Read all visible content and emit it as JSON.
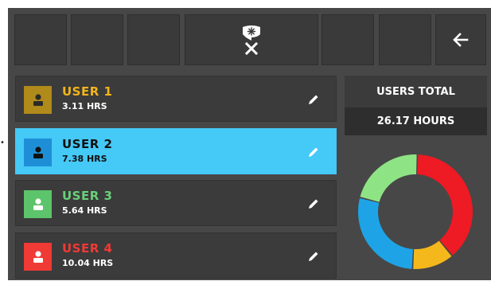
{
  "toolbar": {
    "left_buttons": [
      "",
      "",
      ""
    ],
    "right_buttons": [
      "",
      ""
    ],
    "center_icon": "fan-heater-off-icon",
    "back_icon": "arrow-left-icon"
  },
  "users": [
    {
      "name": "USER 1",
      "hours": "3.11 HRS",
      "color": "#b08a1a",
      "name_color": "#f2b41c",
      "selected": false
    },
    {
      "name": "USER 2",
      "hours": "7.38 HRS",
      "color": "#1e8fd6",
      "name_color": "#111111",
      "selected": true
    },
    {
      "name": "USER 3",
      "hours": "5.64 HRS",
      "color": "#5cc46a",
      "name_color": "#6ad07a",
      "selected": false
    },
    {
      "name": "USER 4",
      "hours": "10.04 HRS",
      "color": "#ef3a36",
      "name_color": "#ef3a36",
      "selected": false
    }
  ],
  "summary": {
    "label": "USERS TOTAL",
    "value": "26.17 HOURS"
  },
  "chart_data": {
    "type": "pie",
    "values": [
      3.11,
      7.38,
      5.64,
      10.04
    ],
    "colors": [
      "#f5b81c",
      "#1ea4e6",
      "#8ee485",
      "#ee1a24"
    ]
  }
}
